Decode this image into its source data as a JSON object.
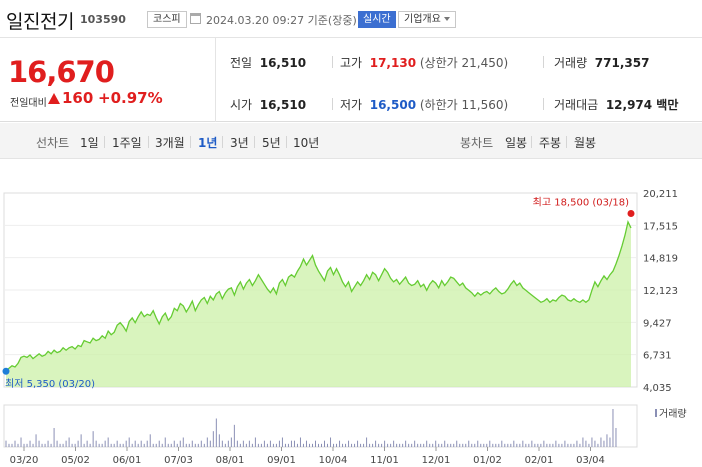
{
  "header": {
    "stock_name": "일진전기",
    "stock_code": "103590",
    "market_badge": "코스피",
    "timestamp": "2024.03.20 09:27 기준(장중)",
    "realtime_badge": "실시간",
    "company_info_button": "기업개요"
  },
  "price": {
    "current": "16,670",
    "change_label": "전일대비",
    "change_value": "160",
    "change_percent": "+0.97%",
    "up_color": "#e01e1e"
  },
  "stats": {
    "prev_close_label": "전일",
    "prev_close": "16,510",
    "open_label": "시가",
    "open": "16,510",
    "high_label": "고가",
    "high": "17,130",
    "upper_limit": "(상한가 21,450)",
    "low_label": "저가",
    "low": "16,500",
    "lower_limit": "(하한가 11,560)",
    "volume_label": "거래량",
    "volume": "771,357",
    "amount_label": "거래대금",
    "amount": "12,974 백만"
  },
  "nav": {
    "line_label": "선차트",
    "line_periods": [
      "1일",
      "1주일",
      "3개월",
      "1년",
      "3년",
      "5년",
      "10년"
    ],
    "active_period": "1년",
    "candle_label": "봉차트",
    "candle_periods": [
      "일봉",
      "주봉",
      "월봉"
    ]
  },
  "chart_data": {
    "type": "area",
    "y_ticks": [
      "20,211",
      "17,515",
      "14,819",
      "12,123",
      "9,427",
      "6,731",
      "4,035"
    ],
    "ylim": [
      4035,
      20211
    ],
    "x_ticks": [
      "03/20",
      "05/02",
      "06/01",
      "07/03",
      "08/01",
      "09/01",
      "10/04",
      "11/01",
      "12/01",
      "01/02",
      "02/01",
      "03/04"
    ],
    "high_annotation": "최고 18,500 (03/18)",
    "low_annotation": "최저 5,350 (03/20)",
    "volume_legend": "거래량",
    "line_color": "#66cc33",
    "fill_color": "#ccf0a8",
    "series": [
      {
        "values": [
          5350,
          5600,
          5800,
          5700,
          6000,
          6500,
          6600,
          6500,
          6700,
          6400,
          6600,
          6800,
          6600,
          6700,
          7000,
          6800,
          7100,
          6900,
          7000,
          7300,
          7100,
          7300,
          7400,
          7200,
          7500,
          7400,
          7900,
          7800,
          7700,
          8100,
          7900,
          8000,
          8300,
          8100,
          8700,
          8400,
          8600,
          9200,
          9400,
          9100,
          8700,
          9500,
          9800,
          9400,
          9900,
          10300,
          9900,
          10100,
          10000,
          10400,
          9800,
          9300,
          9900,
          10200,
          9600,
          9900,
          10600,
          10400,
          11000,
          10800,
          10300,
          10700,
          11200,
          10400,
          10900,
          11300,
          11500,
          11000,
          11600,
          11300,
          11800,
          12000,
          11400,
          11900,
          12200,
          12300,
          11700,
          12400,
          12800,
          12200,
          12700,
          13000,
          12500,
          12900,
          13400,
          13000,
          12600,
          12200,
          11900,
          12300,
          11800,
          12700,
          13000,
          12500,
          13200,
          13400,
          13200,
          13700,
          14100,
          14700,
          14200,
          14600,
          15000,
          14200,
          13700,
          13300,
          12900,
          13700,
          14000,
          13400,
          13900,
          13400,
          12800,
          12400,
          12800,
          12000,
          12400,
          12800,
          12500,
          12900,
          13400,
          13000,
          13600,
          13400,
          12900,
          13400,
          13900,
          13600,
          13100,
          12800,
          13000,
          12600,
          12900,
          13200,
          12700,
          12500,
          12600,
          12900,
          12400,
          12600,
          12100,
          12600,
          12900,
          12700,
          12300,
          12900,
          12500,
          12800,
          13200,
          13100,
          12800,
          12500,
          12700,
          12300,
          12100,
          11900,
          11600,
          11900,
          11700,
          11900,
          12000,
          11800,
          12100,
          12300,
          12000,
          11800,
          11900,
          12200,
          12600,
          12900,
          12500,
          12700,
          12300,
          12100,
          11900,
          11700,
          11500,
          11300,
          11100,
          11200,
          11400,
          11100,
          11300,
          11200,
          11500,
          11700,
          11600,
          11300,
          11200,
          11400,
          11200,
          11100,
          11300,
          11100,
          11300,
          12100,
          12800,
          12400,
          12900,
          13300,
          13000,
          13400,
          13700,
          14300,
          15000,
          15800,
          16700,
          17800,
          17300
        ]
      }
    ],
    "volume": [
      2,
      1,
      1,
      2,
      1,
      3,
      1,
      1,
      2,
      1,
      4,
      2,
      1,
      1,
      2,
      1,
      6,
      2,
      1,
      1,
      2,
      3,
      1,
      1,
      2,
      4,
      1,
      2,
      1,
      5,
      2,
      1,
      1,
      2,
      3,
      1,
      1,
      2,
      1,
      1,
      2,
      3,
      1,
      2,
      1,
      2,
      1,
      2,
      4,
      1,
      1,
      2,
      1,
      3,
      1,
      1,
      2,
      1,
      2,
      3,
      1,
      1,
      2,
      1,
      1,
      2,
      1,
      3,
      2,
      5,
      9,
      4,
      2,
      1,
      2,
      3,
      7,
      2,
      1,
      2,
      1,
      2,
      1,
      3,
      1,
      1,
      2,
      1,
      2,
      1,
      1,
      2,
      3,
      1,
      1,
      2,
      2,
      1,
      3,
      1,
      2,
      1,
      1,
      2,
      1,
      1,
      2,
      1,
      3,
      1,
      1,
      2,
      1,
      1,
      2,
      1,
      1,
      2,
      1,
      1,
      3,
      1,
      1,
      2,
      1,
      1,
      2,
      1,
      1,
      2,
      1,
      1,
      1,
      2,
      1,
      1,
      2,
      1,
      1,
      1,
      2,
      1,
      1,
      2,
      1,
      1,
      2,
      1,
      1,
      1,
      2,
      1,
      1,
      1,
      2,
      1,
      1,
      2,
      1,
      1,
      1,
      2,
      1,
      1,
      1,
      2,
      1,
      1,
      1,
      2,
      1,
      1,
      2,
      1,
      1,
      2,
      1,
      1,
      1,
      2,
      1,
      1,
      1,
      2,
      1,
      1,
      2,
      1,
      1,
      1,
      2,
      1,
      3,
      2,
      1,
      3,
      2,
      1,
      3,
      2,
      4,
      3,
      12,
      6
    ]
  }
}
